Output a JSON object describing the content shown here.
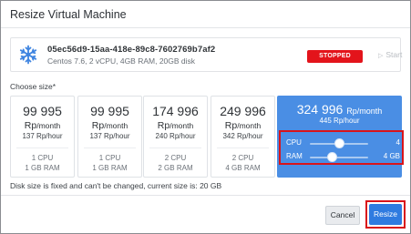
{
  "dialog": {
    "title": "Resize Virtual Machine"
  },
  "vm": {
    "name": "05ec56d9-15aa-418e-89c8-7602769b7af2",
    "spec": "Centos 7.6, 2 vCPU, 4GB RAM, 20GB disk",
    "status": "STOPPED",
    "status_color": "#e3141b",
    "start_label": "Start",
    "icon": "vm-snowflake-icon"
  },
  "choose_label": "Choose size*",
  "plans": [
    {
      "price": "99 995",
      "currency": "Rp",
      "per_month": "/month",
      "hourly": "137 Rp/hour",
      "cpu": "1 CPU",
      "ram": "1 GB RAM"
    },
    {
      "price": "99 995",
      "currency": "Rp",
      "per_month": "/month",
      "hourly": "137 Rp/hour",
      "cpu": "1 CPU",
      "ram": "1 GB RAM"
    },
    {
      "price": "174 996",
      "currency": "Rp",
      "per_month": "/month",
      "hourly": "240 Rp/hour",
      "cpu": "2 CPU",
      "ram": "2 GB RAM"
    },
    {
      "price": "249 996",
      "currency": "Rp",
      "per_month": "/month",
      "hourly": "342 Rp/hour",
      "cpu": "2 CPU",
      "ram": "4 GB RAM"
    }
  ],
  "custom_plan": {
    "price": "324 996",
    "currency_unit": "Rp/month",
    "hourly": "445 Rp/hour",
    "accent_color": "#4a8ee4",
    "cpu": {
      "label": "CPU",
      "value": "4",
      "level": 0.5
    },
    "ram": {
      "label": "RAM",
      "value": "4 GB",
      "level": 0.375
    }
  },
  "disk_note": "Disk size is fixed and can't be changed, current size is: 20 GB",
  "footer": {
    "cancel_label": "Cancel",
    "resize_label": "Resize",
    "resize_color": "#2f7be0"
  }
}
